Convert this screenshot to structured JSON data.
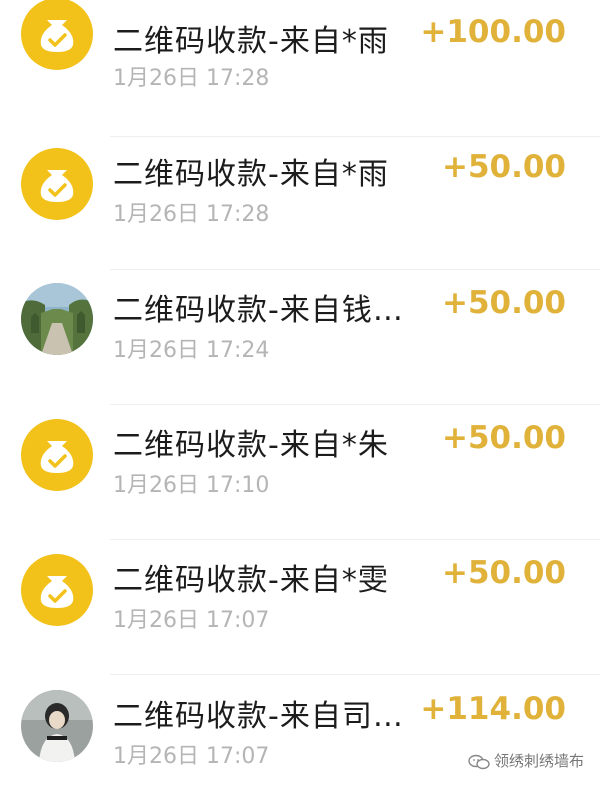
{
  "transactions": [
    {
      "title": "二维码收款-来自*雨",
      "time": "1月26日 17:28",
      "amount": "+100.00",
      "avatar": "money-bag-icon"
    },
    {
      "title": "二维码收款-来自*雨",
      "time": "1月26日 17:28",
      "amount": "+50.00",
      "avatar": "money-bag-icon"
    },
    {
      "title": "二维码收款-来自钱…",
      "time": "1月26日 17:24",
      "amount": "+50.00",
      "avatar": "photo-avatar-road"
    },
    {
      "title": "二维码收款-来自*朱",
      "time": "1月26日 17:10",
      "amount": "+50.00",
      "avatar": "money-bag-icon"
    },
    {
      "title": "二维码收款-来自*雯",
      "time": "1月26日 17:07",
      "amount": "+50.00",
      "avatar": "money-bag-icon"
    },
    {
      "title": "二维码收款-来自司…",
      "time": "1月26日 17:07",
      "amount": "+114.00",
      "avatar": "photo-avatar-person"
    }
  ],
  "colors": {
    "coin": "#f2c21a",
    "amount": "#e0b23a",
    "title": "#1c1c1c",
    "time": "#b5b5b5"
  },
  "watermark": {
    "text": "领绣刺绣墙布"
  }
}
